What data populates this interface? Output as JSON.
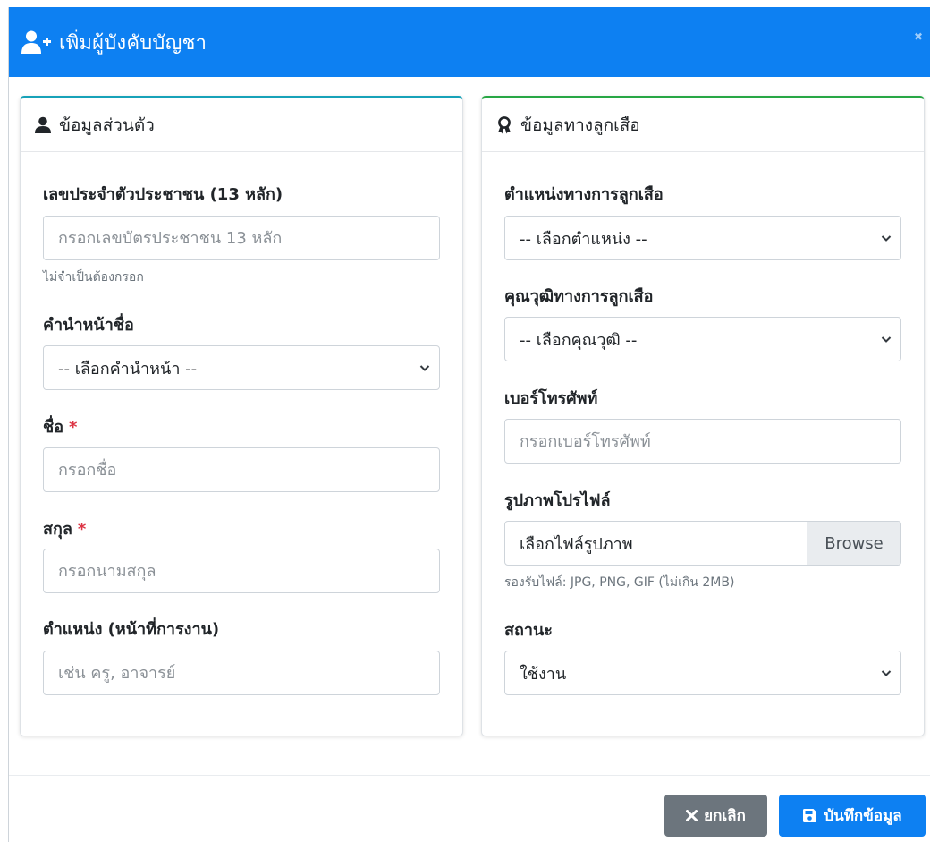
{
  "modal": {
    "title": "เพิ่มผู้บังคับบัญชา",
    "close_label": "✖",
    "colors": {
      "header": "#0d80f2",
      "left_accent": "#17a2b8",
      "right_accent": "#28a745",
      "required": "#dc3545"
    }
  },
  "personal": {
    "title": "ข้อมูลส่วนตัว",
    "icon": "user-icon",
    "id_label": "เลขประจำตัวประชาชน (13 หลัก)",
    "id_placeholder": "กรอกเลขบัตรประชาชน 13 หลัก",
    "id_help": "ไม่จำเป็นต้องกรอก",
    "prefix_label": "คำนำหน้าชื่อ",
    "prefix_selected": "-- เลือกคำนำหน้า --",
    "first_label": "ชื่อ",
    "first_placeholder": "กรอกชื่อ",
    "last_label": "สกุล",
    "last_placeholder": "กรอกนามสกุล",
    "required_mark": "*",
    "position_label": "ตำแหน่ง (หน้าที่การงาน)",
    "position_placeholder": "เช่น ครู, อาจารย์"
  },
  "scout": {
    "title": "ข้อมูลทางลูกเสือ",
    "icon": "award-icon",
    "scout_position_label": "ตำแหน่งทางการลูกเสือ",
    "scout_position_selected": "-- เลือกตำแหน่ง --",
    "qualification_label": "คุณวุฒิทางการลูกเสือ",
    "qualification_selected": "-- เลือกคุณวุฒิ --",
    "phone_label": "เบอร์โทรศัพท์",
    "phone_placeholder": "กรอกเบอร์โทรศัพท์",
    "photo_label": "รูปภาพโปรไฟล์",
    "photo_text": "เลือกไฟล์รูปภาพ",
    "browse_label": "Browse",
    "photo_help": "รองรับไฟล์: JPG, PNG, GIF (ไม่เกิน 2MB)",
    "status_label": "สถานะ",
    "status_selected": "ใช้งาน"
  },
  "footer": {
    "cancel_label": "ยกเลิก",
    "save_label": "บันทึกข้อมูล"
  }
}
